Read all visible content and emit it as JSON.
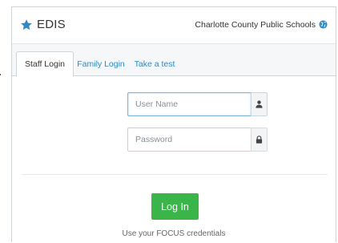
{
  "header": {
    "app_name": "EDIS",
    "district": "Charlotte County Public Schools"
  },
  "tabs": [
    {
      "label": "Staff Login",
      "active": true
    },
    {
      "label": "Family Login",
      "active": false
    },
    {
      "label": "Take a test",
      "active": false
    }
  ],
  "form": {
    "username_placeholder": "User Name",
    "username_value": "",
    "password_placeholder": "Password",
    "password_value": "",
    "login_label": "Log In",
    "hint": "Use your FOCUS credentials"
  },
  "icons": {
    "brand": "star-icon",
    "district": "globe-icon",
    "username": "user-icon",
    "password": "lock-icon"
  },
  "colors": {
    "brand_star": "#2f8ac4",
    "tab_link": "#2f8ac4",
    "login_button": "#39b54a",
    "focused_border": "#7eb6df"
  }
}
